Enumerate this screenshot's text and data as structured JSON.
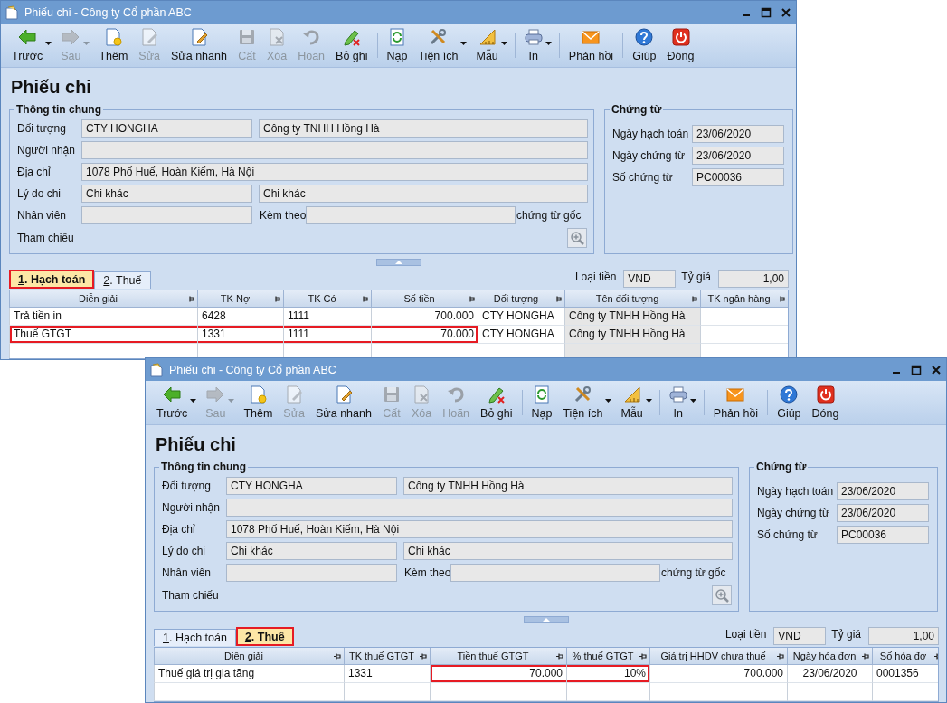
{
  "windows": [
    {
      "title": "Phiếu chi - Công ty Cổ phần ABC",
      "toolbar": [
        {
          "kind": "button",
          "label": "Trước",
          "disabled": false,
          "dropdown": true
        },
        {
          "kind": "button",
          "label": "Sau",
          "disabled": true,
          "dropdown": true
        },
        {
          "kind": "button",
          "label": "Thêm",
          "disabled": false,
          "dropdown": false
        },
        {
          "kind": "button",
          "label": "Sửa",
          "disabled": true,
          "dropdown": false
        },
        {
          "kind": "button",
          "label": "Sửa nhanh",
          "disabled": false,
          "dropdown": false
        },
        {
          "kind": "button",
          "label": "Cất",
          "disabled": true,
          "dropdown": false
        },
        {
          "kind": "button",
          "label": "Xóa",
          "disabled": true,
          "dropdown": false
        },
        {
          "kind": "button",
          "label": "Hoãn",
          "disabled": true,
          "dropdown": false
        },
        {
          "kind": "button",
          "label": "Bỏ ghi",
          "disabled": false,
          "dropdown": false
        },
        {
          "kind": "separator"
        },
        {
          "kind": "button",
          "label": "Nạp",
          "disabled": false,
          "dropdown": false
        },
        {
          "kind": "button",
          "label": "Tiện ích",
          "disabled": false,
          "dropdown": true
        },
        {
          "kind": "button",
          "label": "Mẫu",
          "disabled": false,
          "dropdown": true
        },
        {
          "kind": "separator"
        },
        {
          "kind": "button",
          "label": "In",
          "disabled": false,
          "dropdown": true
        },
        {
          "kind": "separator"
        },
        {
          "kind": "button",
          "label": "Phản hồi",
          "disabled": false,
          "dropdown": false
        },
        {
          "kind": "separator"
        },
        {
          "kind": "button",
          "label": "Giúp",
          "disabled": false,
          "dropdown": false
        },
        {
          "kind": "button",
          "label": "Đóng",
          "disabled": false,
          "dropdown": false
        }
      ],
      "heading": "Phiếu chi",
      "general_info": {
        "title": "Thông tin chung",
        "rows": [
          {
            "kind": "pair",
            "label": "Đối tượng",
            "values": [
              "CTY HONGHA",
              "Công ty TNHH Hồng Hà"
            ]
          },
          {
            "kind": "wide",
            "label": "Người nhận"
          },
          {
            "kind": "wide",
            "label": "Địa chỉ",
            "values": [
              "1078 Phố Huế, Hoàn Kiếm, Hà Nội"
            ]
          },
          {
            "kind": "pair",
            "label": "Lý do chi",
            "values": [
              "Chi khác",
              "Chi khác"
            ]
          },
          {
            "kind": "attachment",
            "label": "Nhân viên",
            "second_label": "Kèm theo",
            "suffix": "chứng từ gốc"
          },
          {
            "kind": "reference",
            "label": "Tham chiếu"
          }
        ]
      },
      "voucher": {
        "title": "Chứng từ",
        "rows": [
          {
            "label": "Ngày hạch toán",
            "value": "23/06/2020"
          },
          {
            "label": "Ngày chứng từ",
            "value": "23/06/2020"
          },
          {
            "label": "Số chứng từ",
            "value": "PC00036"
          }
        ]
      },
      "tabs": [
        {
          "label": "1. Hạch toán",
          "selected": true
        },
        {
          "label": "2. Thuế",
          "selected": false
        }
      ],
      "currency": {
        "label": "Loại tiền",
        "value": "VND"
      },
      "exchange_rate": {
        "label": "Tỷ giá",
        "value": "1,00"
      },
      "table": {
        "columns": [
          {
            "title": "Diễn giải",
            "kind": "text",
            "readonly": false
          },
          {
            "title": "TK Nợ",
            "kind": "text",
            "readonly": false
          },
          {
            "title": "TK Có",
            "kind": "text",
            "readonly": false
          },
          {
            "title": "Số tiền",
            "kind": "number",
            "readonly": false
          },
          {
            "title": "Đối tượng",
            "kind": "text",
            "readonly": false
          },
          {
            "title": "Tên đối tượng",
            "kind": "text",
            "readonly": true
          },
          {
            "title": "TK ngân hàng",
            "kind": "text",
            "readonly": false
          }
        ],
        "rows": [
          {
            "cells": [
              {
                "text": "Trả tiền in",
                "highlighted": false
              },
              {
                "text": "6428",
                "highlighted": false
              },
              {
                "text": "1111",
                "highlighted": false
              },
              {
                "text": "700.000",
                "highlighted": false
              },
              {
                "text": "CTY HONGHA",
                "highlighted": false
              },
              {
                "text": "Công ty TNHH Hồng Hà",
                "highlighted": false
              },
              {
                "highlighted": false
              }
            ]
          },
          {
            "cells": [
              {
                "text": "Thuế GTGT",
                "highlighted": true
              },
              {
                "text": "1331",
                "highlighted": true
              },
              {
                "text": "1111",
                "highlighted": true
              },
              {
                "text": "70.000",
                "highlighted": true
              },
              {
                "text": "CTY HONGHA",
                "highlighted": false
              },
              {
                "text": "Công ty TNHH Hồng Hà",
                "highlighted": false
              },
              {
                "highlighted": false
              }
            ]
          }
        ]
      }
    },
    {
      "title": "Phiếu chi - Công ty Cổ phần ABC",
      "toolbar": [
        {
          "kind": "button",
          "label": "Trước",
          "disabled": false,
          "dropdown": true
        },
        {
          "kind": "button",
          "label": "Sau",
          "disabled": true,
          "dropdown": true
        },
        {
          "kind": "button",
          "label": "Thêm",
          "disabled": false,
          "dropdown": false
        },
        {
          "kind": "button",
          "label": "Sửa",
          "disabled": true,
          "dropdown": false
        },
        {
          "kind": "button",
          "label": "Sửa nhanh",
          "disabled": false,
          "dropdown": false
        },
        {
          "kind": "button",
          "label": "Cất",
          "disabled": true,
          "dropdown": false
        },
        {
          "kind": "button",
          "label": "Xóa",
          "disabled": true,
          "dropdown": false
        },
        {
          "kind": "button",
          "label": "Hoãn",
          "disabled": true,
          "dropdown": false
        },
        {
          "kind": "button",
          "label": "Bỏ ghi",
          "disabled": false,
          "dropdown": false
        },
        {
          "kind": "separator"
        },
        {
          "kind": "button",
          "label": "Nạp",
          "disabled": false,
          "dropdown": false
        },
        {
          "kind": "button",
          "label": "Tiện ích",
          "disabled": false,
          "dropdown": true
        },
        {
          "kind": "button",
          "label": "Mẫu",
          "disabled": false,
          "dropdown": true
        },
        {
          "kind": "separator"
        },
        {
          "kind": "button",
          "label": "In",
          "disabled": false,
          "dropdown": true
        },
        {
          "kind": "separator"
        },
        {
          "kind": "button",
          "label": "Phản hồi",
          "disabled": false,
          "dropdown": false
        },
        {
          "kind": "separator"
        },
        {
          "kind": "button",
          "label": "Giúp",
          "disabled": false,
          "dropdown": false
        },
        {
          "kind": "button",
          "label": "Đóng",
          "disabled": false,
          "dropdown": false
        }
      ],
      "heading": "Phiếu chi",
      "general_info": {
        "title": "Thông tin chung",
        "rows": [
          {
            "kind": "pair",
            "label": "Đối tượng",
            "values": [
              "CTY HONGHA",
              "Công ty TNHH Hồng Hà"
            ]
          },
          {
            "kind": "wide",
            "label": "Người nhận"
          },
          {
            "kind": "wide",
            "label": "Địa chỉ",
            "values": [
              "1078 Phố Huế, Hoàn Kiếm, Hà Nội"
            ]
          },
          {
            "kind": "pair",
            "label": "Lý do chi",
            "values": [
              "Chi khác",
              "Chi khác"
            ]
          },
          {
            "kind": "attachment",
            "label": "Nhân viên",
            "second_label": "Kèm theo",
            "suffix": "chứng từ gốc"
          },
          {
            "kind": "reference",
            "label": "Tham chiếu"
          }
        ]
      },
      "voucher": {
        "title": "Chứng từ",
        "rows": [
          {
            "label": "Ngày hạch toán",
            "value": "23/06/2020"
          },
          {
            "label": "Ngày chứng từ",
            "value": "23/06/2020"
          },
          {
            "label": "Số chứng từ",
            "value": "PC00036"
          }
        ]
      },
      "tabs": [
        {
          "label": "1. Hạch toán",
          "selected": false
        },
        {
          "label": "2. Thuế",
          "selected": true
        }
      ],
      "currency": {
        "label": "Loại tiền",
        "value": "VND"
      },
      "exchange_rate": {
        "label": "Tỷ giá",
        "value": "1,00"
      },
      "table": {
        "columns": [
          {
            "title": "Diễn giải",
            "kind": "text",
            "readonly": false
          },
          {
            "title": "TK thuế GTGT",
            "kind": "text",
            "readonly": false
          },
          {
            "title": "Tiền thuế GTGT",
            "kind": "number",
            "readonly": false
          },
          {
            "title": "% thuế GTGT",
            "kind": "number",
            "readonly": false
          },
          {
            "title": "Giá trị HHDV chưa thuế",
            "kind": "number",
            "readonly": false
          },
          {
            "title": "Ngày hóa đơn",
            "kind": "date",
            "readonly": false
          },
          {
            "title": "Số hóa đơ",
            "kind": "text",
            "readonly": false
          }
        ],
        "rows": [
          {
            "cells": [
              {
                "text": "Thuế giá trị gia tăng",
                "highlighted": false
              },
              {
                "text": "1331",
                "highlighted": false
              },
              {
                "text": "70.000",
                "highlighted": true
              },
              {
                "text": "10%",
                "highlighted": true
              },
              {
                "text": "700.000",
                "highlighted": false
              },
              {
                "text": "23/06/2020",
                "highlighted": false
              },
              {
                "text": "0001356",
                "highlighted": false
              }
            ]
          }
        ]
      }
    }
  ]
}
